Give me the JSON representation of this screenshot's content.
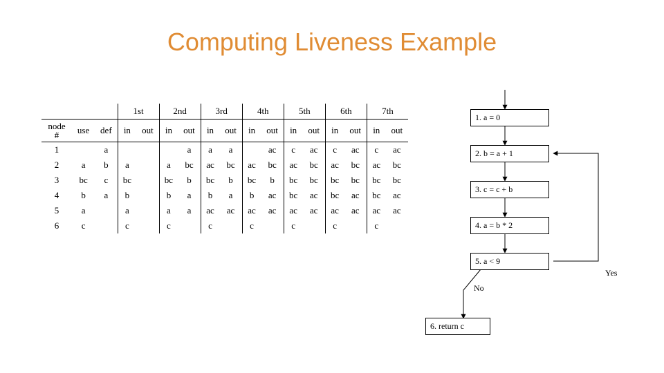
{
  "title": "Computing Liveness Example",
  "iterations": [
    "1st",
    "2nd",
    "3rd",
    "4th",
    "5th",
    "6th",
    "7th"
  ],
  "header": {
    "node": "node\n#",
    "use": "use",
    "def": "def",
    "in": "in",
    "out": "out"
  },
  "rows": [
    {
      "n": "1",
      "use": "",
      "def": "a",
      "cells": [
        [
          "",
          ""
        ],
        [
          "",
          "a"
        ],
        [
          "a",
          "a"
        ],
        [
          "",
          "ac"
        ],
        [
          "c",
          "ac"
        ],
        [
          "c",
          "ac"
        ],
        [
          "c",
          "ac"
        ]
      ]
    },
    {
      "n": "2",
      "use": "a",
      "def": "b",
      "cells": [
        [
          "a",
          ""
        ],
        [
          "a",
          "bc"
        ],
        [
          "ac",
          "bc"
        ],
        [
          "ac",
          "bc"
        ],
        [
          "ac",
          "bc"
        ],
        [
          "ac",
          "bc"
        ],
        [
          "ac",
          "bc"
        ]
      ]
    },
    {
      "n": "3",
      "use": "bc",
      "def": "c",
      "cells": [
        [
          "bc",
          ""
        ],
        [
          "bc",
          "b"
        ],
        [
          "bc",
          "b"
        ],
        [
          "bc",
          "b"
        ],
        [
          "bc",
          "bc"
        ],
        [
          "bc",
          "bc"
        ],
        [
          "bc",
          "bc"
        ]
      ]
    },
    {
      "n": "4",
      "use": "b",
      "def": "a",
      "cells": [
        [
          "b",
          ""
        ],
        [
          "b",
          "a"
        ],
        [
          "b",
          "a"
        ],
        [
          "b",
          "ac"
        ],
        [
          "bc",
          "ac"
        ],
        [
          "bc",
          "ac"
        ],
        [
          "bc",
          "ac"
        ]
      ]
    },
    {
      "n": "5",
      "use": "a",
      "def": "",
      "cells": [
        [
          "a",
          ""
        ],
        [
          "a",
          "a"
        ],
        [
          "ac",
          "ac"
        ],
        [
          "ac",
          "ac"
        ],
        [
          "ac",
          "ac"
        ],
        [
          "ac",
          "ac"
        ],
        [
          "ac",
          "ac"
        ]
      ]
    },
    {
      "n": "6",
      "use": "c",
      "def": "",
      "cells": [
        [
          "c",
          ""
        ],
        [
          "c",
          ""
        ],
        [
          "c",
          ""
        ],
        [
          "c",
          ""
        ],
        [
          "c",
          ""
        ],
        [
          "c",
          ""
        ],
        [
          "c",
          ""
        ]
      ]
    }
  ],
  "cfg": {
    "n1": "1.   a = 0",
    "n2": "2.   b = a + 1",
    "n3": "3.    c = c + b",
    "n4": "4.    a = b * 2",
    "n5": "5.    a < 9",
    "n6": "6. return c",
    "no": "No",
    "yes": "Yes"
  }
}
